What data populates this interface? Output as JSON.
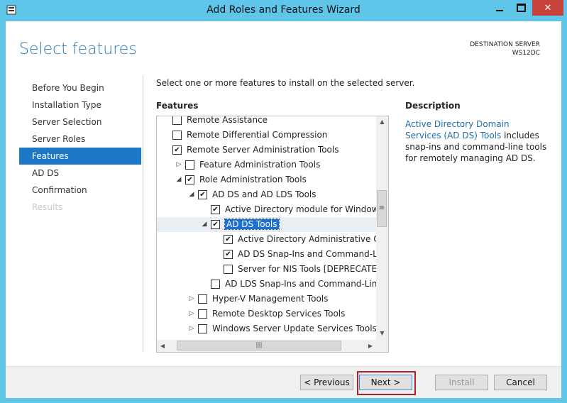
{
  "window": {
    "title": "Add Roles and Features Wizard",
    "close_glyph": "✕"
  },
  "page": {
    "title": "Select features",
    "destination_label": "DESTINATION SERVER",
    "destination_server": "WS12DC",
    "instruction": "Select one or more features to install on the selected server."
  },
  "nav": {
    "items": [
      {
        "label": "Before You Begin",
        "state": "normal"
      },
      {
        "label": "Installation Type",
        "state": "normal"
      },
      {
        "label": "Server Selection",
        "state": "normal"
      },
      {
        "label": "Server Roles",
        "state": "normal"
      },
      {
        "label": "Features",
        "state": "active"
      },
      {
        "label": "AD DS",
        "state": "normal"
      },
      {
        "label": "Confirmation",
        "state": "normal"
      },
      {
        "label": "Results",
        "state": "disabled"
      }
    ]
  },
  "features": {
    "label": "Features",
    "rows": [
      {
        "label": "Remote Assistance",
        "checked": false,
        "indent": 0,
        "expander": ""
      },
      {
        "label": "Remote Differential Compression",
        "checked": false,
        "indent": 0,
        "expander": ""
      },
      {
        "label": "Remote Server Administration Tools",
        "checked": true,
        "indent": 0,
        "expander": ""
      },
      {
        "label": "Feature Administration Tools",
        "checked": false,
        "indent": 1,
        "expander": "collapsed"
      },
      {
        "label": "Role Administration Tools",
        "checked": true,
        "indent": 1,
        "expander": "expanded"
      },
      {
        "label": "AD DS and AD LDS Tools",
        "checked": true,
        "indent": 2,
        "expander": "expanded"
      },
      {
        "label": "Active Directory module for Windows PowerShell",
        "checked": true,
        "indent": 3,
        "expander": ""
      },
      {
        "label": "AD DS Tools",
        "checked": true,
        "indent": 3,
        "expander": "expanded",
        "selected": true
      },
      {
        "label": "Active Directory Administrative Center",
        "checked": true,
        "indent": 4,
        "expander": ""
      },
      {
        "label": "AD DS Snap-Ins and Command-Line Tools",
        "checked": true,
        "indent": 4,
        "expander": ""
      },
      {
        "label": "Server for NIS Tools [DEPRECATED]",
        "checked": false,
        "indent": 4,
        "expander": ""
      },
      {
        "label": "AD LDS Snap-Ins and Command-Line Tools",
        "checked": false,
        "indent": 3,
        "expander": ""
      },
      {
        "label": "Hyper-V Management Tools",
        "checked": false,
        "indent": 2,
        "expander": "collapsed"
      },
      {
        "label": "Remote Desktop Services Tools",
        "checked": false,
        "indent": 2,
        "expander": "collapsed"
      },
      {
        "label": "Windows Server Update Services Tools",
        "checked": false,
        "indent": 2,
        "expander": "collapsed"
      }
    ]
  },
  "description": {
    "label": "Description",
    "link_text": "Active Directory Domain Services (AD DS) Tools",
    "body_text": " includes snap-ins and command-line tools for remotely managing AD DS."
  },
  "buttons": {
    "previous": "< Previous",
    "next": "Next >",
    "install": "Install",
    "cancel": "Cancel"
  },
  "glyphs": {
    "check": "✔",
    "expanded": "◢",
    "collapsed": "▷",
    "scroll_up": "▲",
    "scroll_down": "▼",
    "scroll_left": "◀",
    "scroll_right": "▶",
    "v_grip": "≡",
    "h_grip": "|||"
  }
}
